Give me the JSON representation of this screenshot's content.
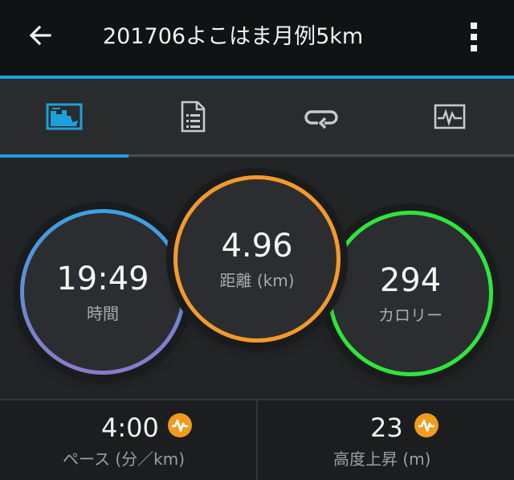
{
  "appbar": {
    "title": "201706よこはま月例5km",
    "back_icon": "arrow-left-icon",
    "menu_icon": "more-vertical-icon"
  },
  "tabs": [
    {
      "icon": "summary-icon",
      "selected": true
    },
    {
      "icon": "details-icon",
      "selected": false
    },
    {
      "icon": "laps-icon",
      "selected": false
    },
    {
      "icon": "chart-icon",
      "selected": false
    }
  ],
  "stats": {
    "time": {
      "value": "19:49",
      "label": "時間"
    },
    "distance": {
      "value": "4.96",
      "label": "距離 (km)"
    },
    "calories": {
      "value": "294",
      "label": "カロリー"
    }
  },
  "bottom": {
    "pace": {
      "value": "4:00",
      "label": "ペース (分／km)",
      "icon": "heart-rate-badge-icon"
    },
    "elevation": {
      "value": "23",
      "label": "高度上昇 (m)",
      "icon": "heart-rate-badge-icon"
    }
  },
  "colors": {
    "accent": "#1ea0dc",
    "distance_ring": "#f39a2c",
    "calories_ring": "#2ee63a",
    "time_ring_top": "#3ba1e3",
    "time_ring_bottom": "#8d79c9",
    "badge": "#f29b1c"
  }
}
